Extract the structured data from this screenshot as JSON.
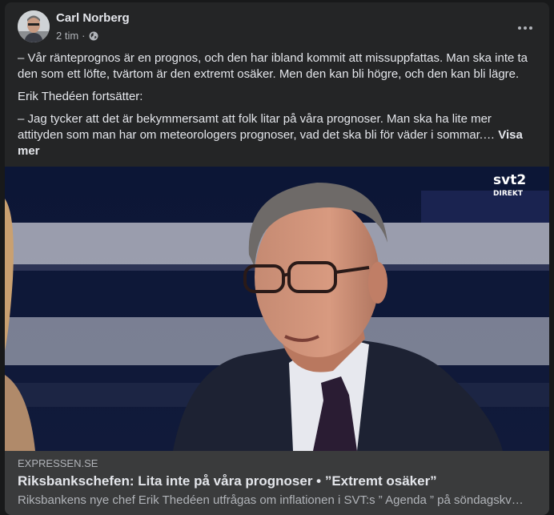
{
  "post": {
    "author": "Carl Norberg",
    "time": "2 tim",
    "dot": "·",
    "privacy_icon": "globe-icon",
    "menu_icon": "more-options-icon",
    "paragraphs": [
      "– Vår ränteprognos är en prognos, och den har ibland kommit att missuppfattas. Man ska inte ta den som ett löfte, tvärtom är den extremt osäker. Men den kan bli högre, och den kan bli lägre.",
      "Erik Thedéen fortsätter:",
      "– Jag tycker att det är bekymmersamt att folk litar på våra prognoser. Man ska ha lite mer attityden som man har om meteorologers prognoser, vad det ska bli för väder i sommar.… "
    ],
    "see_more": "Visa mer"
  },
  "media": {
    "channel_logo": "svt2",
    "channel_sub": "DIREKT"
  },
  "link": {
    "domain": "EXPRESSEN.SE",
    "headline": "Riksbankschefen: Lita inte på våra prognoser • ”Extremt osäker”",
    "description": "Riksbankens nye chef Erik Thedéen utfrågas om inflationen i SVT:s ” Agenda ” på söndagskv…"
  },
  "colors": {
    "background": "#18191a",
    "card": "#242526",
    "preview": "#3a3b3c",
    "text_primary": "#e4e6eb",
    "text_secondary": "#b0b3b8"
  }
}
